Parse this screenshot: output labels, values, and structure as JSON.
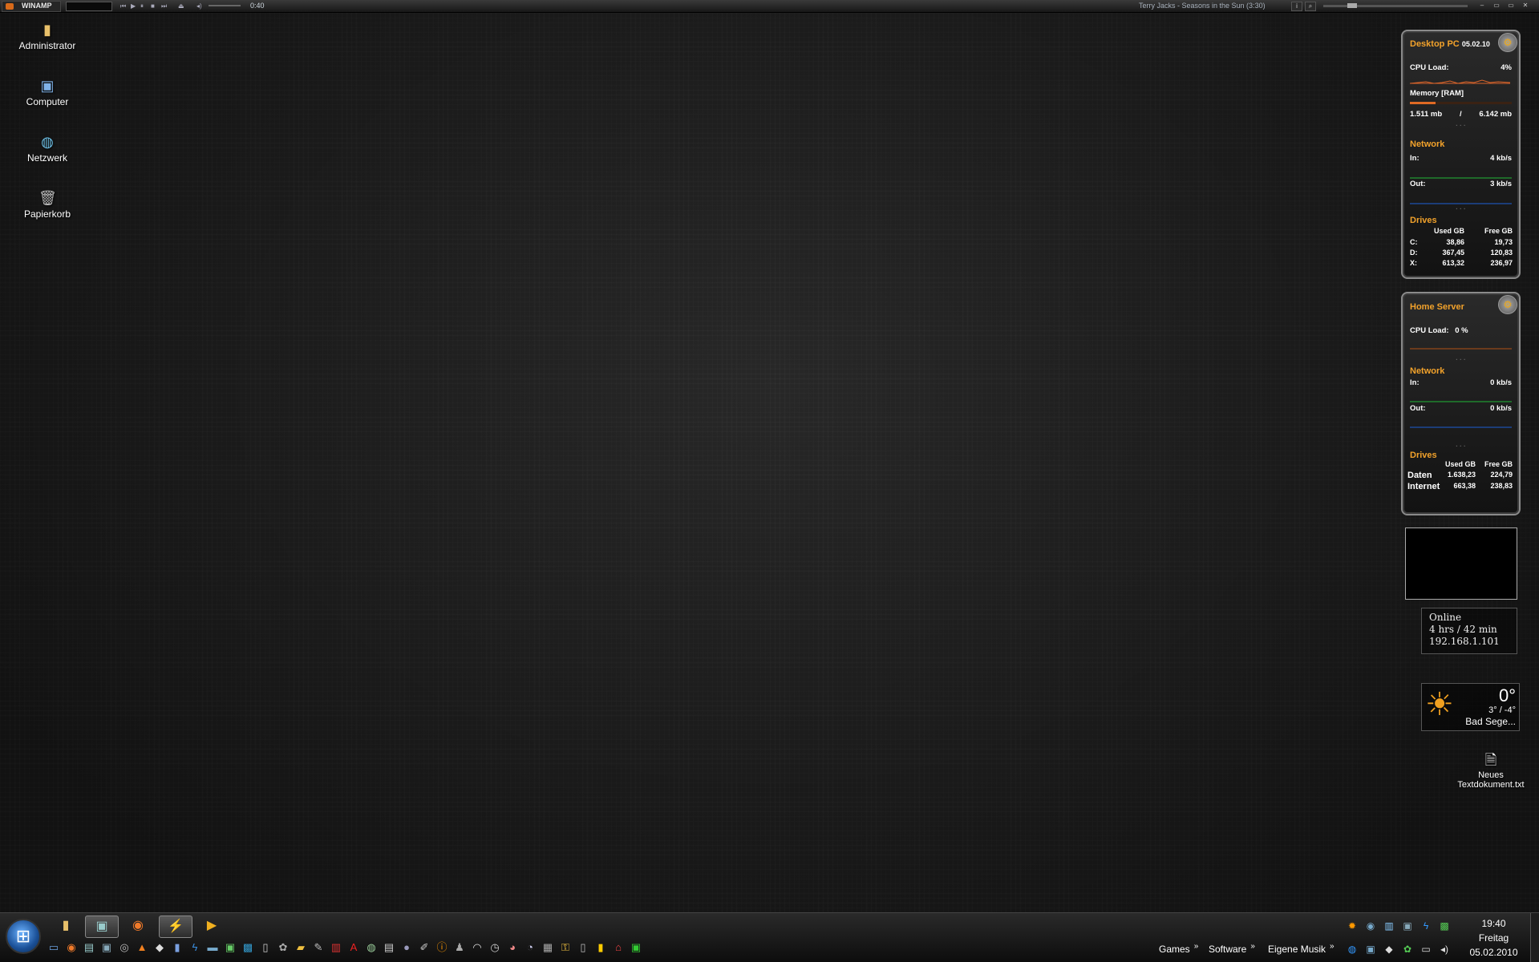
{
  "winamp": {
    "logo": "WINAMP",
    "time": "0:40",
    "song": "Terry Jacks - Seasons in the Sun (3:30)"
  },
  "desktop_icons": [
    {
      "label": "Administrator",
      "icon": "user-folder-icon"
    },
    {
      "label": "Computer",
      "icon": "computer-icon"
    },
    {
      "label": "Netzwerk",
      "icon": "network-icon"
    },
    {
      "label": "Papierkorb",
      "icon": "recycle-bin-icon"
    }
  ],
  "desktop_pc": {
    "title": "Desktop PC",
    "date": "05.02.10",
    "cpu_label": "CPU Load:",
    "cpu_value": "4%",
    "memory_label": "Memory [RAM]",
    "memory_used": "1.511 mb",
    "memory_sep": "/",
    "memory_total": "6.142 mb",
    "network_label": "Network",
    "in_label": "In:",
    "in_value": "4 kb/s",
    "out_label": "Out:",
    "out_value": "3 kb/s",
    "drives_label": "Drives",
    "used_header": "Used GB",
    "free_header": "Free GB",
    "drives": [
      {
        "name": "C:",
        "used": "38,86",
        "free": "19,73"
      },
      {
        "name": "D:",
        "used": "367,45",
        "free": "120,83"
      },
      {
        "name": "X:",
        "used": "613,32",
        "free": "236,97"
      }
    ]
  },
  "home_server": {
    "title": "Home Server",
    "cpu_label": "CPU Load:",
    "cpu_value": "0 %",
    "network_label": "Network",
    "in_label": "In:",
    "in_value": "0 kb/s",
    "out_label": "Out:",
    "out_value": "0 kb/s",
    "drives_label": "Drives",
    "used_header": "Used GB",
    "free_header": "Free GB",
    "drives": [
      {
        "name": "Daten",
        "used": "1.638,23",
        "free": "224,79"
      },
      {
        "name": "Internet",
        "used": "663,38",
        "free": "238,83"
      }
    ]
  },
  "online": {
    "status": "Online",
    "duration": "4 hrs / 42 min",
    "ip": "192.168.1.101"
  },
  "weather": {
    "temp": "0°",
    "range": "3° / -4°",
    "city": "Bad Sege..."
  },
  "desktop_file": {
    "line1": "Neues",
    "line2": "Textdokument.txt"
  },
  "taskbar": {
    "links": [
      {
        "label": "Games"
      },
      {
        "label": "Software"
      },
      {
        "label": "Eigene Musik"
      }
    ],
    "time": "19:40",
    "day": "Freitag",
    "date": "05.02.2010"
  },
  "colors": {
    "accent": "#f2a22b",
    "cpu_graph": "#d9642a",
    "net_in": "#1f6a2a",
    "net_out": "#1c3d78"
  }
}
